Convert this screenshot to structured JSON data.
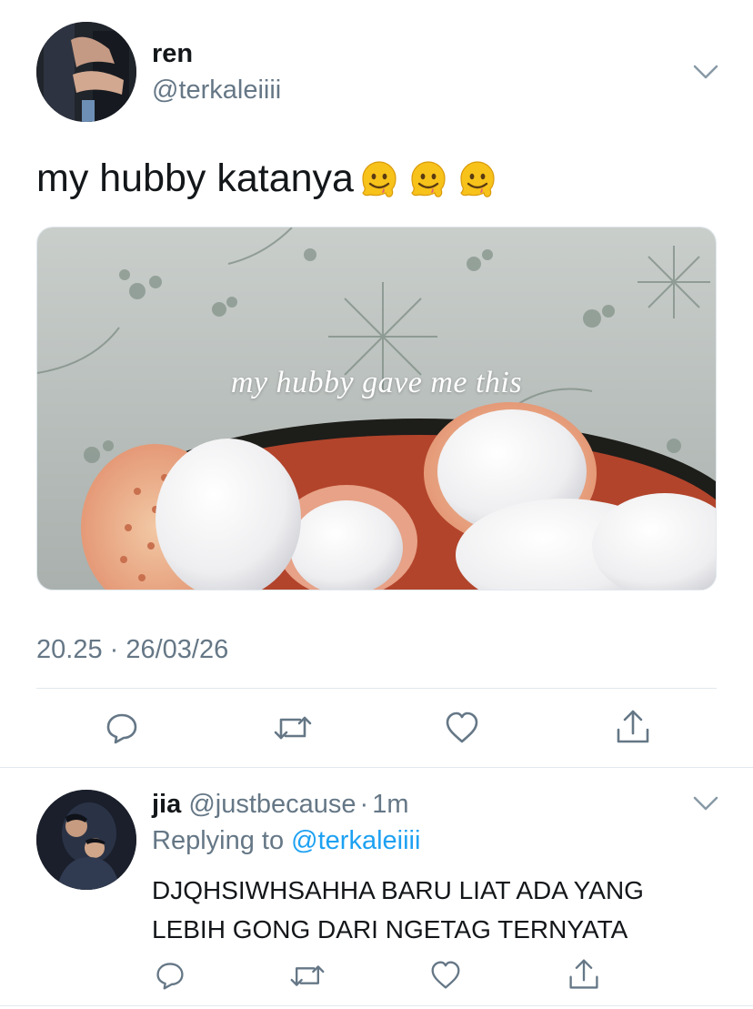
{
  "tweet": {
    "display_name": "ren",
    "handle": "@terkaleiiii",
    "text": "my hubby katanya",
    "emojis": [
      "melting-face-emoji",
      "melting-face-emoji",
      "melting-face-emoji"
    ],
    "image_caption": "my hubby gave me this",
    "timestamp": "20.25 · 26/03/26",
    "actions": [
      "reply-icon",
      "retweet-icon",
      "like-icon",
      "share-icon"
    ]
  },
  "reply": {
    "display_name": "jia",
    "handle": "@justbecause",
    "separator": "·",
    "time": "1m",
    "replying_prefix": "Replying to",
    "replying_to": "@terkaleiiii",
    "text_line1": "DJQHSIWHSAHHA BARU LIAT ADA YANG",
    "text_line2": "LEBIH GONG DARI NGETAG TERNYATA",
    "actions": [
      "reply-icon",
      "retweet-icon",
      "like-icon",
      "share-icon"
    ]
  },
  "colors": {
    "text": "#14171a",
    "muted": "#657786",
    "link": "#1da1f2",
    "divider": "#e1e8ed"
  }
}
